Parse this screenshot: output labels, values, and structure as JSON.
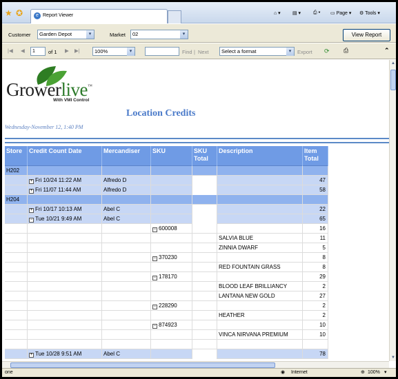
{
  "browser": {
    "tab_title": "Report Viewer",
    "tools_page": "Page",
    "tools_tools": "Tools"
  },
  "params": {
    "customer_label": "Customer",
    "customer_value": "Garden Depot",
    "market_label": "Market",
    "market_value": "02",
    "view_report": "View Report"
  },
  "toolbar": {
    "page_value": "1",
    "page_of": "of 1",
    "zoom": "100%",
    "find": "Find",
    "sep": "|",
    "next": "Next",
    "format": "Select a format",
    "export": "Export"
  },
  "report": {
    "logo_grower": "Grower",
    "logo_live": "live",
    "logo_tm": "™",
    "logo_sub": "With VMI Control",
    "title": "Location Credits",
    "date": "Wednesday-November 12, 1:40 PM",
    "columns": [
      "Store",
      "Credit Count Date",
      "Mercandiser",
      "SKU",
      "SKU Total",
      "Description",
      "Item Total"
    ],
    "rows": [
      {
        "type": "grp",
        "store": "H202",
        "date": "",
        "merch": "",
        "sku": "",
        "skutotal": "",
        "desc": "",
        "total": ""
      },
      {
        "type": "sub",
        "store": "",
        "date": "Fri 10/24 11:22 AM",
        "toggle": "+",
        "merch": "Alfredo D",
        "sku": "",
        "skutotal": "",
        "desc": "",
        "total": "47"
      },
      {
        "type": "sub",
        "store": "",
        "date": "Fri 11/07 11:44 AM",
        "toggle": "+",
        "merch": "Alfredo D",
        "sku": "",
        "skutotal": "",
        "desc": "",
        "total": "58"
      },
      {
        "type": "grp",
        "store": "H204",
        "date": "",
        "merch": "",
        "sku": "",
        "skutotal": "",
        "desc": "",
        "total": ""
      },
      {
        "type": "sub",
        "store": "",
        "date": "Fri 10/17 10:13 AM",
        "toggle": "+",
        "merch": "Abel C",
        "sku": "",
        "skutotal": "",
        "desc": "",
        "total": "22"
      },
      {
        "type": "sub",
        "store": "",
        "date": "Tue 10/21 9:49 AM",
        "toggle": "−",
        "merch": "Abel C",
        "sku": "",
        "skutotal": "",
        "desc": "",
        "total": "65"
      },
      {
        "type": "sku",
        "store": "",
        "date": "",
        "merch": "",
        "sku": "600008",
        "skutoggle": "−",
        "skutotal": "",
        "desc": "",
        "total": "16"
      },
      {
        "type": "item",
        "store": "",
        "date": "",
        "merch": "",
        "sku": "",
        "skutotal": "",
        "desc": "SALVIA BLUE",
        "total": "11"
      },
      {
        "type": "item",
        "store": "",
        "date": "",
        "merch": "",
        "sku": "",
        "skutotal": "",
        "desc": "ZINNIA DWARF",
        "total": "5"
      },
      {
        "type": "sku",
        "store": "",
        "date": "",
        "merch": "",
        "sku": "370230",
        "skutoggle": "−",
        "skutotal": "",
        "desc": "",
        "total": "8"
      },
      {
        "type": "item",
        "store": "",
        "date": "",
        "merch": "",
        "sku": "",
        "skutotal": "",
        "desc": "RED FOUNTAIN GRASS",
        "total": "8"
      },
      {
        "type": "sku",
        "store": "",
        "date": "",
        "merch": "",
        "sku": "178170",
        "skutoggle": "−",
        "skutotal": "",
        "desc": "",
        "total": "29"
      },
      {
        "type": "item",
        "store": "",
        "date": "",
        "merch": "",
        "sku": "",
        "skutotal": "",
        "desc": "BLOOD LEAF BRILLIANCY",
        "total": "2"
      },
      {
        "type": "item",
        "store": "",
        "date": "",
        "merch": "",
        "sku": "",
        "skutotal": "",
        "desc": "LANTANA NEW GOLD",
        "total": "27"
      },
      {
        "type": "sku",
        "store": "",
        "date": "",
        "merch": "",
        "sku": "228290",
        "skutoggle": "−",
        "skutotal": "",
        "desc": "",
        "total": "2"
      },
      {
        "type": "item",
        "store": "",
        "date": "",
        "merch": "",
        "sku": "",
        "skutotal": "",
        "desc": "HEATHER",
        "total": "2"
      },
      {
        "type": "sku",
        "store": "",
        "date": "",
        "merch": "",
        "sku": "874923",
        "skutoggle": "−",
        "skutotal": "",
        "desc": "",
        "total": "10"
      },
      {
        "type": "item",
        "store": "",
        "date": "",
        "merch": "",
        "sku": "",
        "skutotal": "",
        "desc": "VINCA NIRVANA PREMIUM",
        "total": "10"
      },
      {
        "type": "blank",
        "store": "",
        "date": "",
        "merch": "",
        "sku": "",
        "skutotal": "",
        "desc": "",
        "total": ""
      },
      {
        "type": "sub",
        "store": "",
        "date": "Tue 10/28 9:51 AM",
        "toggle": "+",
        "merch": "Abel C",
        "sku": "",
        "skutotal": "",
        "desc": "",
        "total": "78"
      }
    ]
  },
  "status": {
    "left": "one",
    "zone": "Internet",
    "zoom": "100%"
  }
}
